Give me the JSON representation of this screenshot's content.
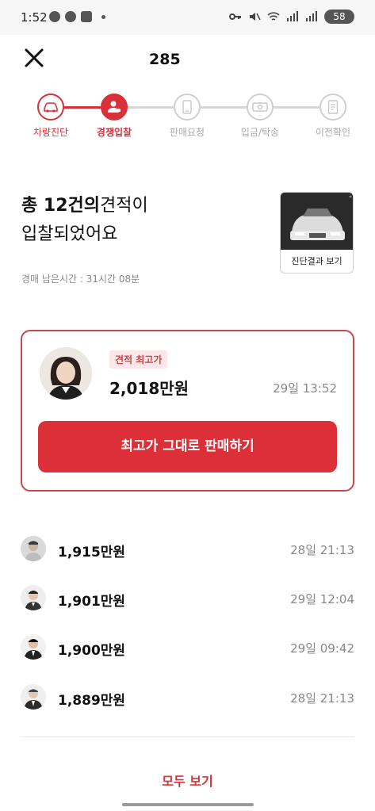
{
  "status_bar": {
    "time": "1:52",
    "battery": "58"
  },
  "header": {
    "title": "285"
  },
  "steps": [
    {
      "label": "차량진단",
      "state": "done",
      "icon": "car-icon"
    },
    {
      "label": "경쟁입찰",
      "state": "active",
      "icon": "bidder-icon"
    },
    {
      "label": "판매요청",
      "state": "pending",
      "icon": "phone-icon"
    },
    {
      "label": "입금/탁송",
      "state": "pending",
      "icon": "money-icon"
    },
    {
      "label": "이전확인",
      "state": "pending",
      "icon": "document-icon"
    }
  ],
  "summary": {
    "prefix": "총 ",
    "count": "12건의",
    "line1_rest": "견적이",
    "line2": "입찰되었어요",
    "remaining": "경매 남은시간 : 31시간 08분"
  },
  "diagnosis_card": {
    "button_label": "진단결과 보기"
  },
  "best_bid": {
    "badge": "견적 최고가",
    "price": "2,018만원",
    "time": "29일 13:52",
    "sell_button": "최고가 그대로 판매하기"
  },
  "bids": [
    {
      "price": "1,915만원",
      "time": "28일 21:13"
    },
    {
      "price": "1,901만원",
      "time": "29일 12:04"
    },
    {
      "price": "1,900만원",
      "time": "29일 09:42"
    },
    {
      "price": "1,889만원",
      "time": "28일 21:13"
    }
  ],
  "view_all": "모두 보기",
  "colors": {
    "accent": "#d93139",
    "border": "#c8474d"
  }
}
